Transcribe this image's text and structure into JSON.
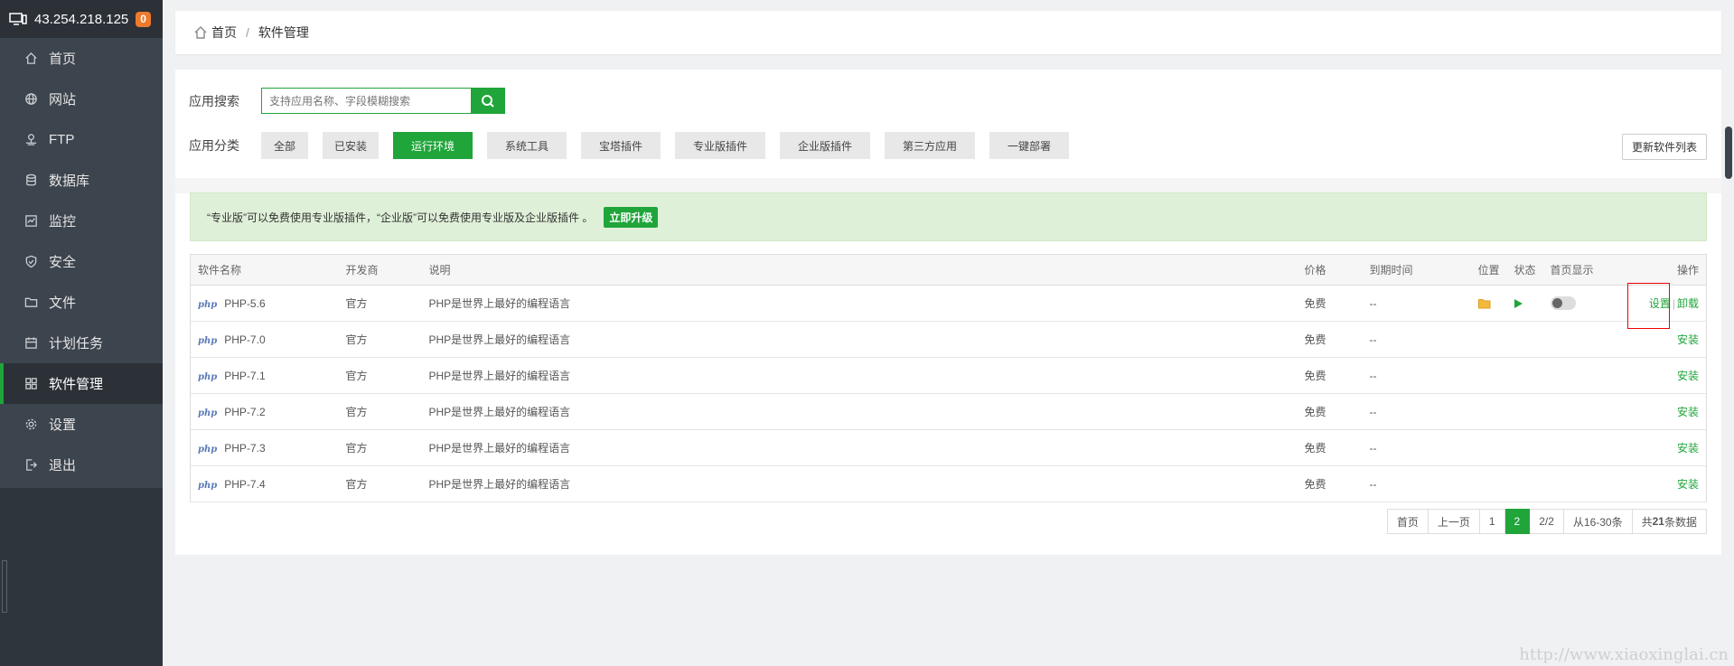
{
  "sidebar": {
    "server_ip": "43.254.218.125",
    "badge": "0",
    "items": [
      {
        "label": "首页",
        "icon": "home-icon"
      },
      {
        "label": "网站",
        "icon": "globe-icon"
      },
      {
        "label": "FTP",
        "icon": "ftp-icon"
      },
      {
        "label": "数据库",
        "icon": "database-icon"
      },
      {
        "label": "监控",
        "icon": "monitor-icon"
      },
      {
        "label": "安全",
        "icon": "shield-icon"
      },
      {
        "label": "文件",
        "icon": "folder-icon"
      },
      {
        "label": "计划任务",
        "icon": "calendar-icon"
      },
      {
        "label": "软件管理",
        "icon": "grid-icon",
        "active": true
      },
      {
        "label": "设置",
        "icon": "gear-icon"
      },
      {
        "label": "退出",
        "icon": "logout-icon"
      }
    ],
    "add_symbol": "+"
  },
  "breadcrumb": {
    "home": "首页",
    "separator": "/",
    "current": "软件管理"
  },
  "search": {
    "label": "应用搜索",
    "placeholder": "支持应用名称、字段模糊搜索"
  },
  "category": {
    "label": "应用分类",
    "items": [
      "全部",
      "已安装",
      "运行环境",
      "系统工具",
      "宝塔插件",
      "专业版插件",
      "企业版插件",
      "第三方应用",
      "一键部署"
    ],
    "active": "运行环境"
  },
  "update_button": "更新软件列表",
  "notice": {
    "text": "“专业版”可以免费使用专业版插件，“企业版”可以免费使用专业版及企业版插件 。",
    "button": "立即升级"
  },
  "table": {
    "headers": [
      "软件名称",
      "开发商",
      "说明",
      "价格",
      "到期时间",
      "位置",
      "状态",
      "首页显示",
      "操作"
    ],
    "rows": [
      {
        "name": "PHP-5.6",
        "dev": "官方",
        "desc": "PHP是世界上最好的编程语言",
        "price": "免费",
        "expire": "--",
        "installed": true,
        "actions": [
          "设置",
          "卸载"
        ]
      },
      {
        "name": "PHP-7.0",
        "dev": "官方",
        "desc": "PHP是世界上最好的编程语言",
        "price": "免费",
        "expire": "--",
        "installed": false,
        "actions": [
          "安装"
        ]
      },
      {
        "name": "PHP-7.1",
        "dev": "官方",
        "desc": "PHP是世界上最好的编程语言",
        "price": "免费",
        "expire": "--",
        "installed": false,
        "actions": [
          "安装"
        ]
      },
      {
        "name": "PHP-7.2",
        "dev": "官方",
        "desc": "PHP是世界上最好的编程语言",
        "price": "免费",
        "expire": "--",
        "installed": false,
        "actions": [
          "安装"
        ]
      },
      {
        "name": "PHP-7.3",
        "dev": "官方",
        "desc": "PHP是世界上最好的编程语言",
        "price": "免费",
        "expire": "--",
        "installed": false,
        "actions": [
          "安装"
        ]
      },
      {
        "name": "PHP-7.4",
        "dev": "官方",
        "desc": "PHP是世界上最好的编程语言",
        "price": "免费",
        "expire": "--",
        "installed": false,
        "actions": [
          "安装"
        ]
      }
    ],
    "logo_text": "php"
  },
  "pager": {
    "first": "首页",
    "prev": "上一页",
    "p1": "1",
    "p2": "2",
    "total_pages": "2/2",
    "range": "从16-30条",
    "total_prefix": "共",
    "total_count": "21",
    "total_suffix": "条数据"
  },
  "watermark": "http://www.xiaoxinglai.cn",
  "colors": {
    "accent": "#20a53a",
    "sidebar": "#3c444d",
    "badge": "#ef7a2c"
  }
}
